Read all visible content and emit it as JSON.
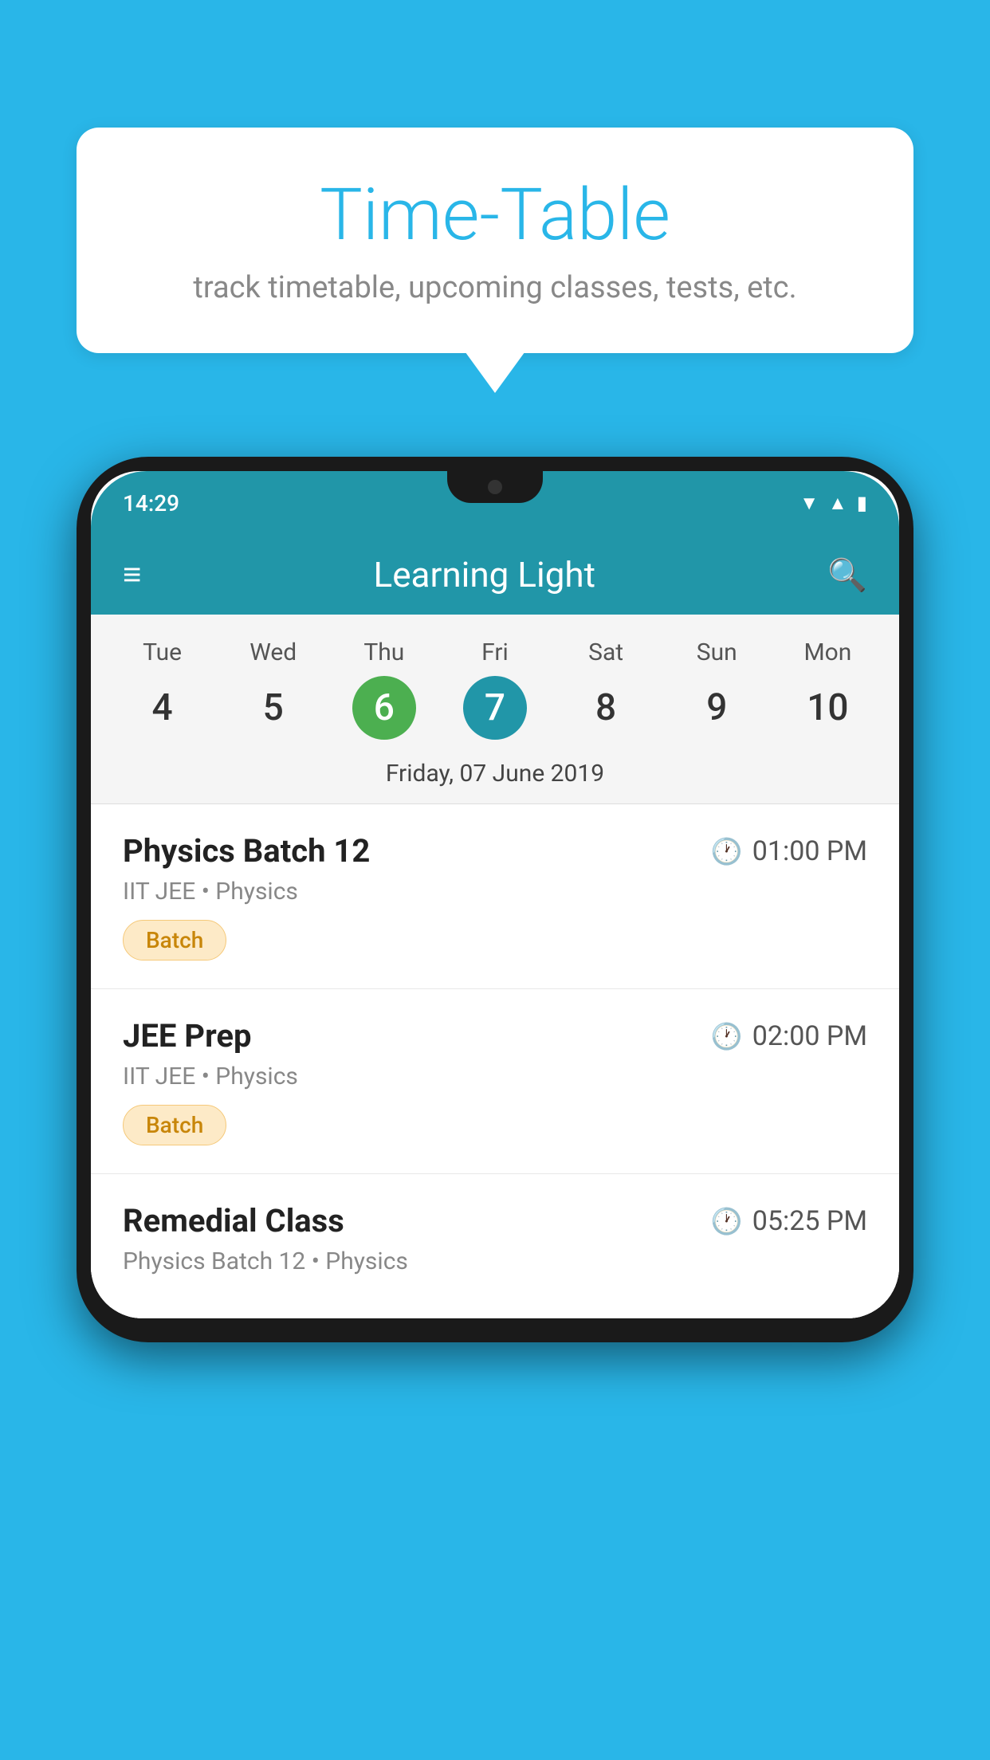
{
  "background_color": "#29b6e8",
  "bubble": {
    "title": "Time-Table",
    "subtitle": "track timetable, upcoming classes, tests, etc."
  },
  "phone": {
    "status_time": "14:29",
    "app_name": "Learning Light",
    "calendar": {
      "days": [
        {
          "name": "Tue",
          "num": "4",
          "state": "normal"
        },
        {
          "name": "Wed",
          "num": "5",
          "state": "normal"
        },
        {
          "name": "Thu",
          "num": "6",
          "state": "today"
        },
        {
          "name": "Fri",
          "num": "7",
          "state": "selected"
        },
        {
          "name": "Sat",
          "num": "8",
          "state": "normal"
        },
        {
          "name": "Sun",
          "num": "9",
          "state": "normal"
        },
        {
          "name": "Mon",
          "num": "10",
          "state": "normal"
        }
      ],
      "selected_date_label": "Friday, 07 June 2019"
    },
    "schedule_items": [
      {
        "title": "Physics Batch 12",
        "time": "01:00 PM",
        "subtitle": "IIT JEE • Physics",
        "badge": "Batch"
      },
      {
        "title": "JEE Prep",
        "time": "02:00 PM",
        "subtitle": "IIT JEE • Physics",
        "badge": "Batch"
      },
      {
        "title": "Remedial Class",
        "time": "05:25 PM",
        "subtitle": "Physics Batch 12 • Physics",
        "badge": null
      }
    ]
  }
}
